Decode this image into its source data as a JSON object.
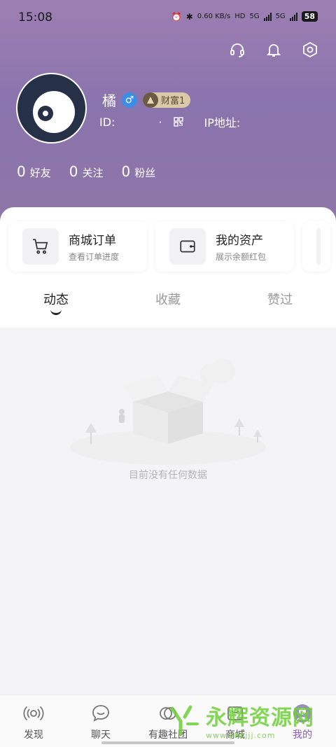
{
  "status_bar": {
    "time": "15:08",
    "speed": "0.60\nKB/s",
    "hd_label": "HD",
    "net1": "5G",
    "net2": "5G",
    "battery": "58"
  },
  "profile": {
    "name": "橘",
    "gender_symbol": "♂",
    "wealth_badge": "财富1",
    "id_label": "ID:",
    "id_value": "·",
    "ip_label": "IP地址:"
  },
  "stats": [
    {
      "count": "0",
      "label": "好友"
    },
    {
      "count": "0",
      "label": "关注"
    },
    {
      "count": "0",
      "label": "粉丝"
    }
  ],
  "cards": [
    {
      "title": "商城订单",
      "subtitle": "查看订单进度",
      "icon": "cart-icon"
    },
    {
      "title": "我的资产",
      "subtitle": "展示余额红包",
      "icon": "wallet-icon"
    }
  ],
  "tabs": [
    {
      "label": "动态",
      "active": true
    },
    {
      "label": "收藏",
      "active": false
    },
    {
      "label": "赞过",
      "active": false
    }
  ],
  "empty_state": {
    "message": "目前没有任何数据"
  },
  "bottom_nav": [
    {
      "label": "发现",
      "icon": "broadcast-icon",
      "active": false
    },
    {
      "label": "聊天",
      "icon": "chat-icon",
      "active": false
    },
    {
      "label": "有趣社团",
      "icon": "group-icon",
      "active": false
    },
    {
      "label": "商城",
      "icon": "shop-icon",
      "active": false
    },
    {
      "label": "我的",
      "icon": "profile-icon",
      "active": true
    }
  ],
  "watermark": {
    "main": "永辉资源网",
    "sub": "www.yhkjjj.com"
  },
  "colors": {
    "header": "#8a74ad",
    "active_nav": "#8a5cc6",
    "gender": "#3a8ee8",
    "watermark": "#6fcf3a"
  }
}
